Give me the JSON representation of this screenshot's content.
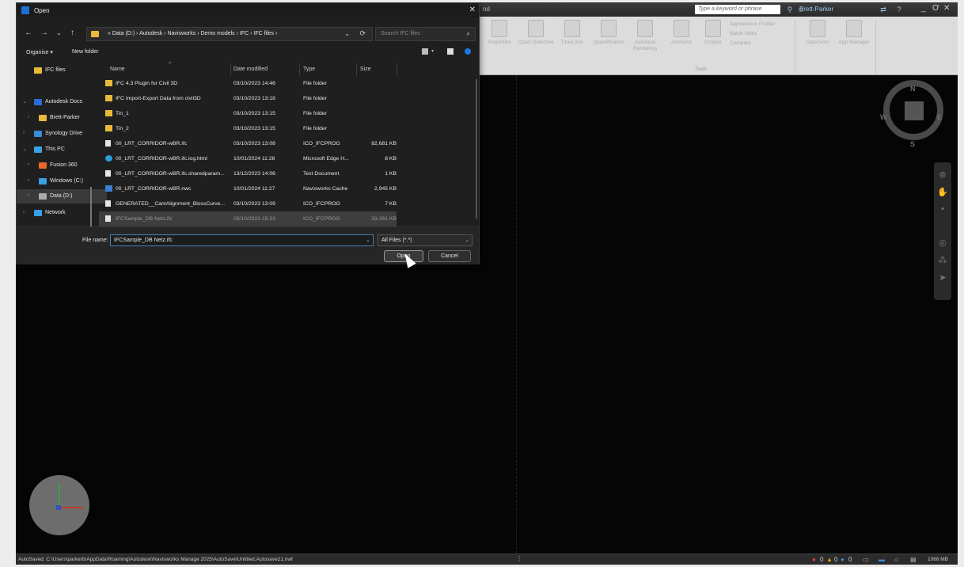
{
  "app": {
    "title_fragment": "nd",
    "search_placeholder": "Type a keyword or phrase",
    "user": "Brett-Parker",
    "window_controls": [
      "_",
      "Ơ",
      "✕"
    ]
  },
  "ribbon": {
    "buttons": [
      "Properties",
      "Clash Detective",
      "TimeLiner",
      "Quantification",
      "Autodesk Rendering",
      "Animator",
      "Scripter",
      "DataTools",
      "App Manager"
    ],
    "small_buttons": [
      "Appearance Profiler",
      "Batch Utility",
      "Compare"
    ],
    "panel_label": "Tools"
  },
  "viewcube": {
    "n": "N",
    "s": "S",
    "e": "E",
    "w": "W"
  },
  "dialog": {
    "title": "Open",
    "breadcrumb": "«  Data (D:)  ›  Autodesk  ›  Navisworks  ›  Demo models  ›  IFC  ›  IFC files  ›",
    "search_placeholder": "Search IFC files",
    "organise": "Organise ▾",
    "new_folder": "New folder",
    "tree": [
      {
        "label": "IFC files",
        "icon": "folder-icon",
        "color": "#e8b93a"
      },
      {
        "label": "Autodesk Docs",
        "icon": "autodesk-docs-icon",
        "color": "#2c6ed5"
      },
      {
        "label": "Brett-Parker",
        "icon": "folder-icon",
        "color": "#e8b93a"
      },
      {
        "label": "Synology Drive",
        "icon": "synology-icon",
        "color": "#3a8bd9"
      },
      {
        "label": "This PC",
        "icon": "pc-icon",
        "color": "#3aa0e6"
      },
      {
        "label": "Fusion 360",
        "icon": "fusion-icon",
        "color": "#e8692c"
      },
      {
        "label": "Windows (C:)",
        "icon": "drive-icon",
        "color": "#3aa0e6"
      },
      {
        "label": "Data (D:)",
        "icon": "drive-icon",
        "color": "#aaaaaa"
      },
      {
        "label": "Network",
        "icon": "network-icon",
        "color": "#3aa0e6"
      }
    ],
    "columns": {
      "name": "Name",
      "date": "Date modified",
      "type": "Type",
      "size": "Size"
    },
    "files": [
      {
        "name": "IFC 4.3 Plugin for Civil 3D",
        "date": "03/10/2023 14:46",
        "type": "File folder",
        "size": "",
        "icon": "folder"
      },
      {
        "name": "IFC Import-Export Data from civil3D",
        "date": "03/10/2023 13:18",
        "type": "File folder",
        "size": "",
        "icon": "folder"
      },
      {
        "name": "Tin_1",
        "date": "03/10/2023 13:15",
        "type": "File folder",
        "size": "",
        "icon": "folder"
      },
      {
        "name": "Tin_2",
        "date": "03/10/2023 13:15",
        "type": "File folder",
        "size": "",
        "icon": "folder"
      },
      {
        "name": "00_LRT_CORRIDOR-wBR.ifc",
        "date": "03/10/2023 13:08",
        "type": "ICO_IFCPROG",
        "size": "82,681 KB",
        "icon": "file"
      },
      {
        "name": "00_LRT_CORRIDOR-wBR.ifc.log.html",
        "date": "10/01/2024 11:26",
        "type": "Microsoft Edge H...",
        "size": "8 KB",
        "icon": "edge"
      },
      {
        "name": "00_LRT_CORRIDOR-wBR.ifc.sharedparam...",
        "date": "13/12/2023 14:06",
        "type": "Text Document",
        "size": "1 KB",
        "icon": "file"
      },
      {
        "name": "00_LRT_CORRIDOR-wBR.nwc",
        "date": "10/01/2024 11:27",
        "type": "Navisworks Cache",
        "size": "2,945 KB",
        "icon": "nwc"
      },
      {
        "name": "GENERATED__CantAlignment_BlossCurve...",
        "date": "03/10/2023 13:09",
        "type": "ICO_IFCPROG",
        "size": "7 KB",
        "icon": "file"
      },
      {
        "name": "IFCSample_DB Netz.ifc",
        "date": "03/10/2023 15:33",
        "type": "ICO_IFCPROG",
        "size": "33,261 KB",
        "icon": "file"
      }
    ],
    "file_name_label": "File name:",
    "file_name_value": "IFCSample_DB Netz.ifc",
    "filter_value": "All Files (*.*)",
    "open_label": "Open",
    "cancel_label": "Cancel"
  },
  "status": {
    "autosave": "AutoSaved: C:\\Users\\parkerb\\AppData\\Roaming\\Autodesk\\Navisworks Manage 2025\\AutoSave\\Untitled.Autosave21.nwf",
    "counts": [
      "0",
      "0",
      "0"
    ],
    "memory": "1068 MB"
  }
}
